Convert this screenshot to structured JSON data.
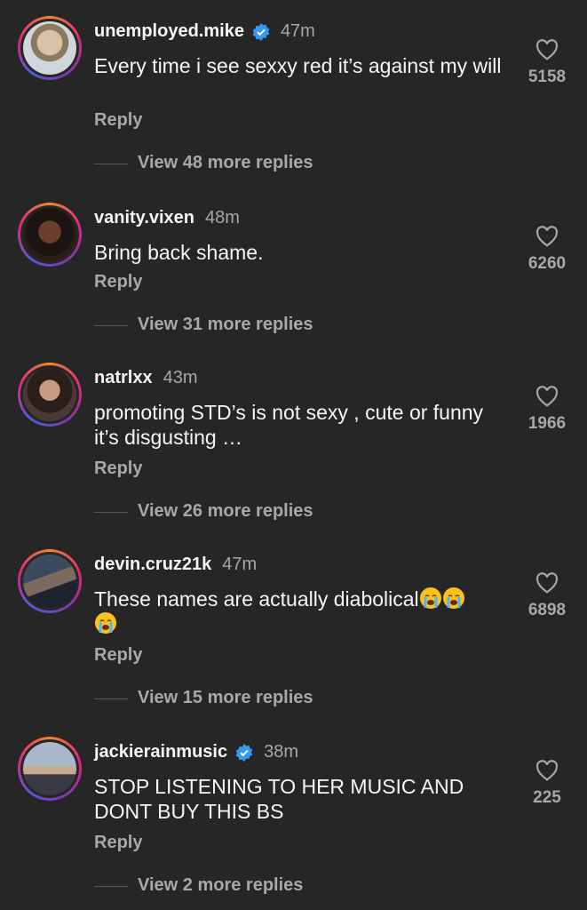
{
  "comments": [
    {
      "username": "unemployed.mike",
      "verified": true,
      "time": "47m",
      "text": "Every time i see sexxy red it’s against my will",
      "reply_label": "Reply",
      "view_more": "View 48 more replies",
      "likes": "5158"
    },
    {
      "username": "vanity.vixen",
      "verified": false,
      "time": "48m",
      "text": "Bring back shame.",
      "reply_label": "Reply",
      "view_more": "View 31 more replies",
      "likes": "6260"
    },
    {
      "username": "natrlxx",
      "verified": false,
      "time": "43m",
      "text": "promoting STD’s is not sexy , cute or funny it’s disgusting …",
      "reply_label": "Reply",
      "view_more": "View 26 more replies",
      "likes": "1966"
    },
    {
      "username": "devin.cruz21k",
      "verified": false,
      "time": "47m",
      "text": "These names are actually diabolical",
      "emoji": "loudly-crying-face x3",
      "reply_label": "Reply",
      "view_more": "View 15 more replies",
      "likes": "6898"
    },
    {
      "username": "jackierainmusic",
      "verified": true,
      "time": "38m",
      "text": "STOP LISTENING TO HER MUSIC AND DONT BUY THIS BS",
      "reply_label": "Reply",
      "view_more": "View 2 more replies",
      "likes": "225"
    }
  ],
  "colors": {
    "background": "#262626",
    "primary_text": "#f5f5f5",
    "secondary_text": "#a8a8a8",
    "verified": "#3897f0"
  }
}
